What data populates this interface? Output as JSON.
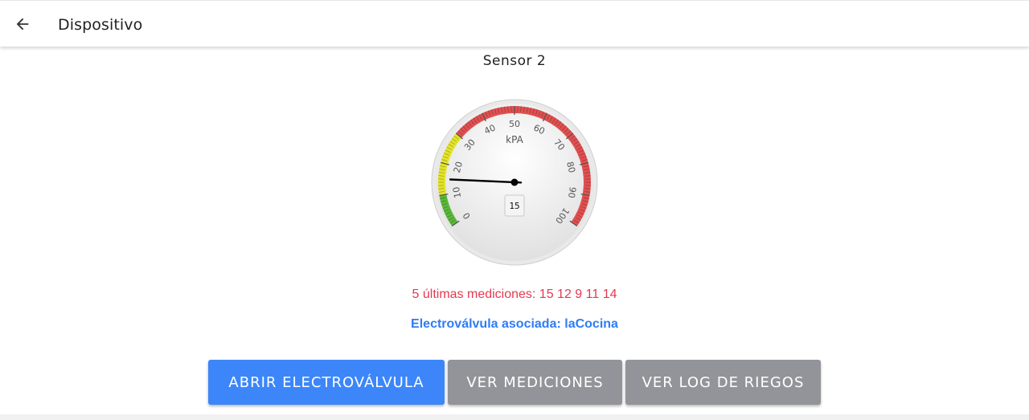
{
  "header": {
    "title": "Dispositivo",
    "back_icon": "arrow-left-icon"
  },
  "sensor": {
    "name": "Sensor 2"
  },
  "gauge": {
    "unit": "kPA",
    "value": 15,
    "value_label": "15",
    "min": 0,
    "max": 100,
    "major_ticks": [
      "0",
      "10",
      "20",
      "30",
      "40",
      "50",
      "60",
      "70",
      "80",
      "90",
      "100"
    ],
    "zones": [
      {
        "from": 0,
        "to": 10,
        "color": "#5cb83a"
      },
      {
        "from": 10,
        "to": 30,
        "color": "#e3e32a"
      },
      {
        "from": 30,
        "to": 100,
        "color": "#e05050"
      }
    ]
  },
  "last_measurements": {
    "text": "5 últimas mediciones: 15 12 9 11 14",
    "values": [
      15,
      12,
      9,
      11,
      14
    ]
  },
  "valve": {
    "text": "Electroválvula asociada: laCocina"
  },
  "buttons": {
    "open_valve": "ABRIR ELECTROVÁLVULA",
    "view_measurements": "VER MEDICIONES",
    "view_log": "VER LOG DE RIEGOS"
  },
  "colors": {
    "primary": "#3c86fa",
    "secondary_button": "#939499",
    "alert_text": "#e53950",
    "link_text": "#2e7cf6"
  }
}
